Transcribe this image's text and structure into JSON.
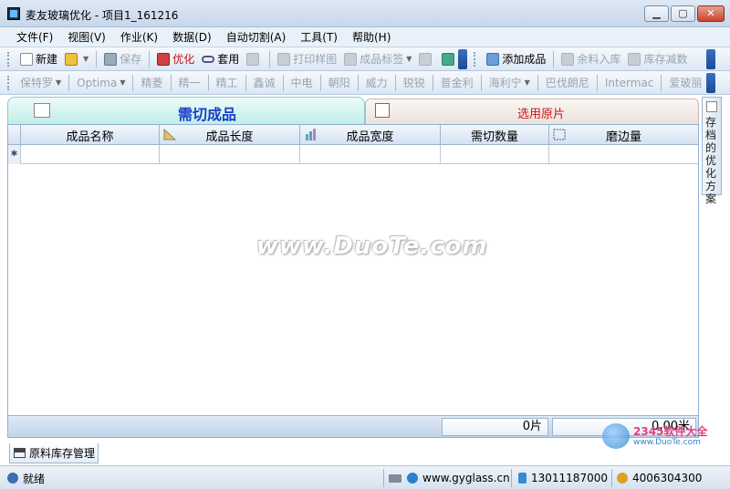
{
  "window": {
    "title": "麦友玻璃优化 - 项目1_161216"
  },
  "menu": [
    "文件(F)",
    "视图(V)",
    "作业(K)",
    "数据(D)",
    "自动切割(A)",
    "工具(T)",
    "帮助(H)"
  ],
  "toolbar1": {
    "new": "新建",
    "save": "保存",
    "optimize": "优化",
    "apply": "套用",
    "print": "打印样图",
    "label": "成品标签",
    "add_product": "添加成品",
    "remnant": "余料入库",
    "stock_reduce": "库存减数"
  },
  "toolbar2": [
    "保特罗",
    "Optima",
    "精菱",
    "精一",
    "精工",
    "鑫诚",
    "中电",
    "朝阳",
    "威力",
    "锐锐",
    "普金利",
    "海利宁",
    "巴伐朗尼",
    "Intermac",
    "爱玻丽"
  ],
  "tabs": {
    "active": "需切成品",
    "inactive": "选用原片"
  },
  "grid": {
    "columns": [
      "成品名称",
      "成品长度",
      "成品宽度",
      "需切数量",
      "磨边量"
    ],
    "new_row_marker": "✱"
  },
  "footer": {
    "pieces": "0片",
    "meters": "0.00米"
  },
  "watermark": "www.DuoTe.com",
  "side_panel": "存档的优化方案",
  "bottom_tab": "原料库存管理",
  "status": {
    "ready": "就绪",
    "website": "www.gyglass.cn",
    "phone": "13011187000",
    "hotline": "4006304300"
  },
  "logo": {
    "name": "2345软件大全",
    "url": "www.DuoTe.com"
  }
}
